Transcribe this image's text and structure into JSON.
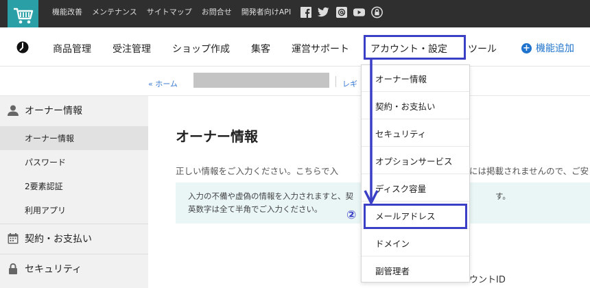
{
  "topbar": {
    "links": [
      "機能改善",
      "メンテナンス",
      "サイトマップ",
      "お問合せ",
      "開発者向けAPI"
    ],
    "social_icons": [
      "facebook-icon",
      "twitter-icon",
      "mail-icon",
      "youtube-icon",
      "lock-icon"
    ],
    "cart_color": "#2a9fa6"
  },
  "nav": {
    "items": [
      "商品管理",
      "受注管理",
      "ショップ作成",
      "集客",
      "運営サポート",
      "アカウント・設定",
      "ツール"
    ],
    "add_feature": "機能追加",
    "accent": "#1f73cc",
    "highlight_color": "#3a3fc6"
  },
  "breadcrumb": {
    "home": "« ホーム",
    "next": "レギ"
  },
  "sidebar": {
    "section1": "オーナー情報",
    "sub_items": [
      "オーナー情報",
      "パスワード",
      "2要素認証",
      "利用アプリ"
    ],
    "section2": "契約・お支払い",
    "section3": "セキュリティ"
  },
  "main": {
    "title": "オーナー情報",
    "intro_left": "正しい情報をご入力ください。こちらで入",
    "intro_right": "には掲載されませんので、ご安",
    "notice_line1": "入力の不備や虚偽の情報を入力されますと、契",
    "notice_line1_right": "す。",
    "notice_line2": "英数字は全て半角でご入力ください。",
    "field_partial": "ウントID"
  },
  "dropdown": {
    "items": [
      "オーナー情報",
      "契約・お支払い",
      "セキュリティ",
      "オプションサービス",
      "ディスク容量",
      "メールアドレス",
      "ドメイン",
      "副管理者"
    ]
  },
  "annotation": {
    "step": "②"
  }
}
